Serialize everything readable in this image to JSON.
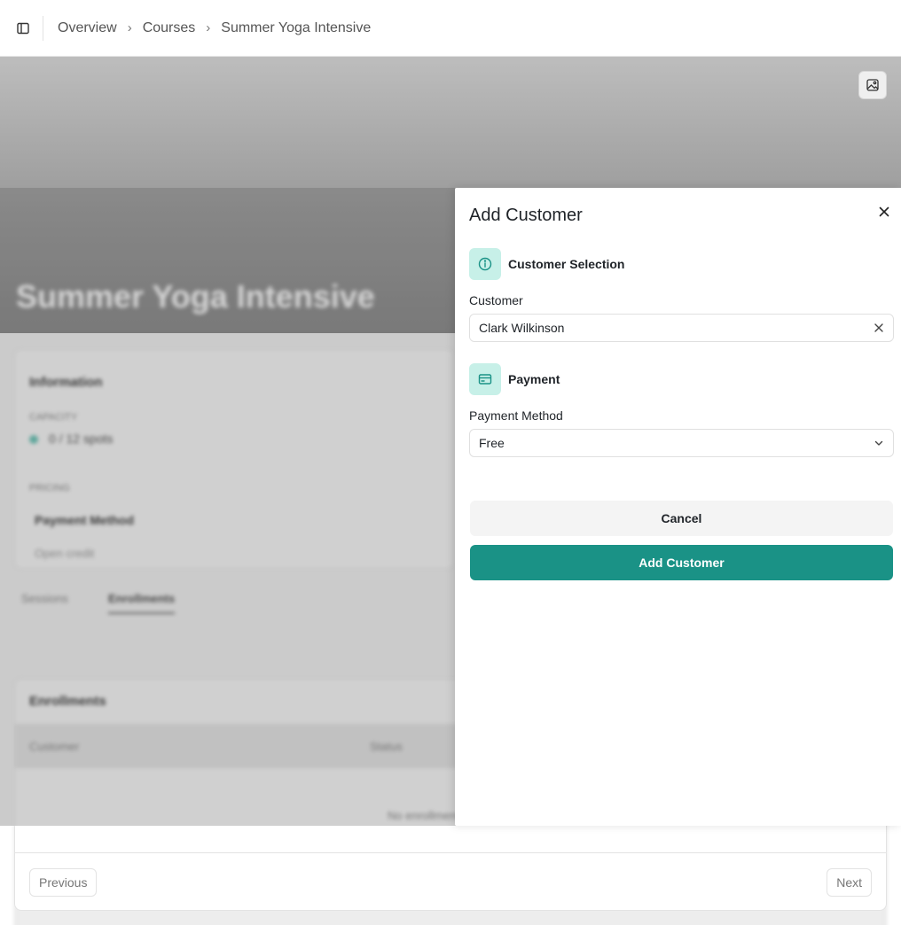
{
  "breadcrumb": {
    "items": [
      "Overview",
      "Courses",
      "Summer Yoga Intensive"
    ],
    "separator": "›"
  },
  "hero": {
    "title": "Summer Yoga Intensive"
  },
  "information": {
    "title": "Information",
    "capacity_label": "CAPACITY",
    "capacity_value": "0 / 12 spots",
    "pricing_label": "PRICING",
    "payment_method_label": "Payment Method",
    "open_text": "Open credit"
  },
  "tabs": [
    "Sessions",
    "Enrollments"
  ],
  "enrollments": {
    "title": "Enrollments",
    "columns": [
      "Customer",
      "Status"
    ],
    "empty_text": "No enrollments"
  },
  "pagination": {
    "previous": "Previous",
    "next": "Next"
  },
  "dialog": {
    "title": "Add Customer",
    "customer_section": "Customer Selection",
    "customer_label": "Customer",
    "customer_value": "Clark Wilkinson",
    "payment_section": "Payment",
    "payment_method_label": "Payment Method",
    "payment_method_value": "Free",
    "cancel_label": "Cancel",
    "submit_label": "Add Customer"
  },
  "colors": {
    "accent": "#1a9286",
    "section_icon_bg": "#c7f0e8"
  }
}
